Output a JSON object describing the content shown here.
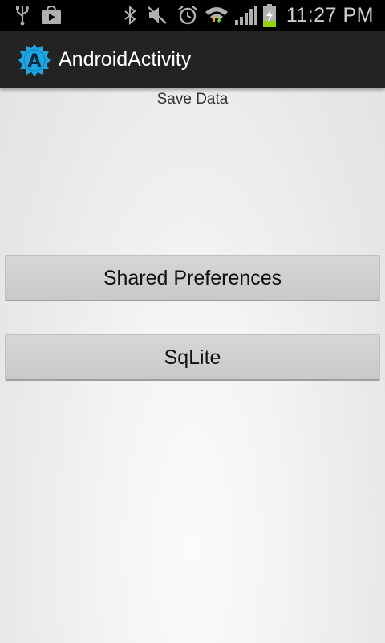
{
  "status_bar": {
    "time": "11:27 PM",
    "icons": [
      "usb-icon",
      "play-store-icon",
      "bluetooth-icon",
      "mute-icon",
      "alarm-icon",
      "wifi-icon",
      "signal-icon",
      "battery-charging-icon"
    ]
  },
  "action_bar": {
    "title": "AndroidActivity",
    "icon": "app-launcher-icon",
    "icon_letter": "A",
    "icon_color": "#1ea6e0"
  },
  "main": {
    "subtitle": "Save Data",
    "buttons": [
      {
        "label": "Shared Preferences"
      },
      {
        "label": "SqLite"
      }
    ]
  }
}
